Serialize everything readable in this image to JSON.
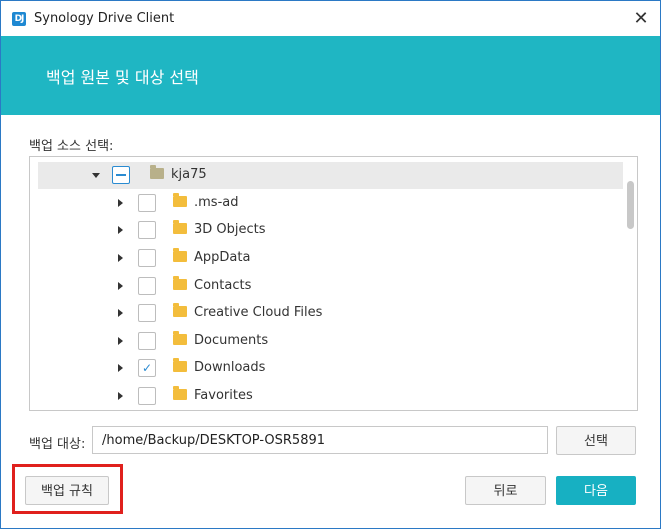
{
  "window": {
    "app_logo": "DJ",
    "title": "Synology Drive Client",
    "close_glyph": "✕"
  },
  "header": {
    "title": "백업 원본 및 대상 선택"
  },
  "source": {
    "label": "백업 소스 선택:",
    "root": {
      "name": "kja75",
      "state": "partial",
      "expanded": true
    },
    "items": [
      {
        "name": ".ms-ad",
        "checked": false
      },
      {
        "name": "3D Objects",
        "checked": false
      },
      {
        "name": "AppData",
        "checked": false
      },
      {
        "name": "Contacts",
        "checked": false
      },
      {
        "name": "Creative Cloud Files",
        "checked": false
      },
      {
        "name": "Documents",
        "checked": false
      },
      {
        "name": "Downloads",
        "checked": true,
        "check_glyph": "✓"
      },
      {
        "name": "Favorites",
        "checked": false
      }
    ]
  },
  "destination": {
    "label": "백업 대상:",
    "value": "/home/Backup/DESKTOP-OSR5891",
    "select_button": "선택"
  },
  "footer": {
    "backup_rules_button": "백업 규칙",
    "back_button": "뒤로",
    "next_button": "다음"
  },
  "colors": {
    "header_band": "#1fb6c3",
    "primary_button": "#17b0c2",
    "highlight": "#e0201d",
    "check": "#2a8bd1",
    "folder": "#f3bd3c"
  }
}
